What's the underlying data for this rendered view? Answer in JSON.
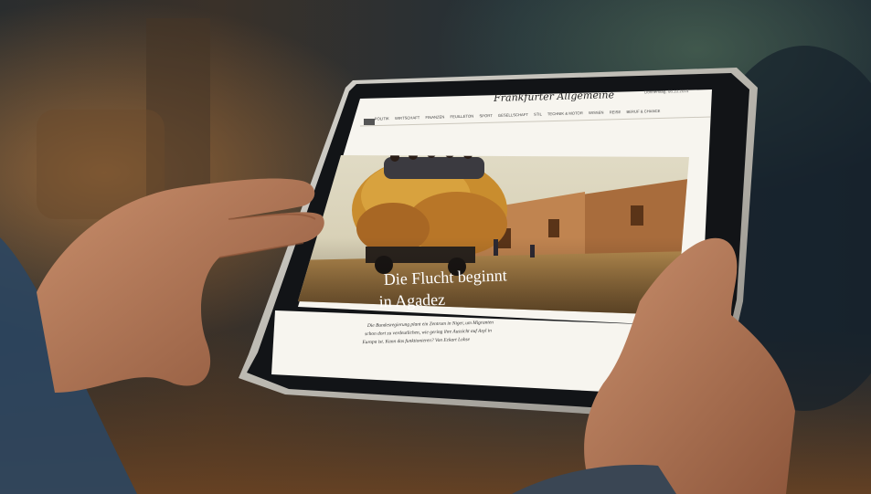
{
  "scene": {
    "description_hidden": false
  },
  "tablet": {
    "masthead": "Frankfurter Allgemeine",
    "date_text": "Donnerstag, 08.10.2015",
    "nav_items": [
      "POLITIK",
      "WIRTSCHAFT",
      "FINANZEN",
      "FEUILLETON",
      "SPORT",
      "GESELLSCHAFT",
      "STIL",
      "TECHNIK & MOTOR",
      "WISSEN",
      "REISE",
      "BERUF & CHANCE"
    ],
    "headline_line1": "Die Flucht beginnt",
    "headline_line2": "in Agadez",
    "teaser_lines": [
      "Die Bundesregierung plant ein Zentrum in Niger, um Migranten",
      "schon dort zu verdeutlichen, wie gering ihre Aussicht auf Asyl in",
      "Europa ist. Kann das funktionieren? Von Eckart Lohse"
    ]
  },
  "colors": {
    "bg_dark": "#1e2a33",
    "warm_light": "#7a4a22",
    "tablet_frame": "#c9c6bf",
    "screen_bg": "#f7f5ef",
    "sky": "#d9d2bb",
    "sand": "#b48a4c",
    "skin": "#b97c5d"
  }
}
